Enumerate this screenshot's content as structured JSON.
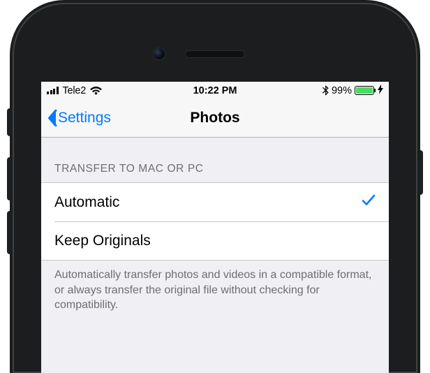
{
  "status": {
    "carrier": "Tele2",
    "time": "10:22 PM",
    "battery_pct": "99%"
  },
  "nav": {
    "back_label": "Settings",
    "title": "Photos"
  },
  "section": {
    "header": "TRANSFER TO MAC OR PC",
    "options": [
      {
        "label": "Automatic",
        "selected": true
      },
      {
        "label": "Keep Originals",
        "selected": false
      }
    ],
    "footer": "Automatically transfer photos and videos in a compatible format, or always transfer the original file without checking for compatibility."
  }
}
